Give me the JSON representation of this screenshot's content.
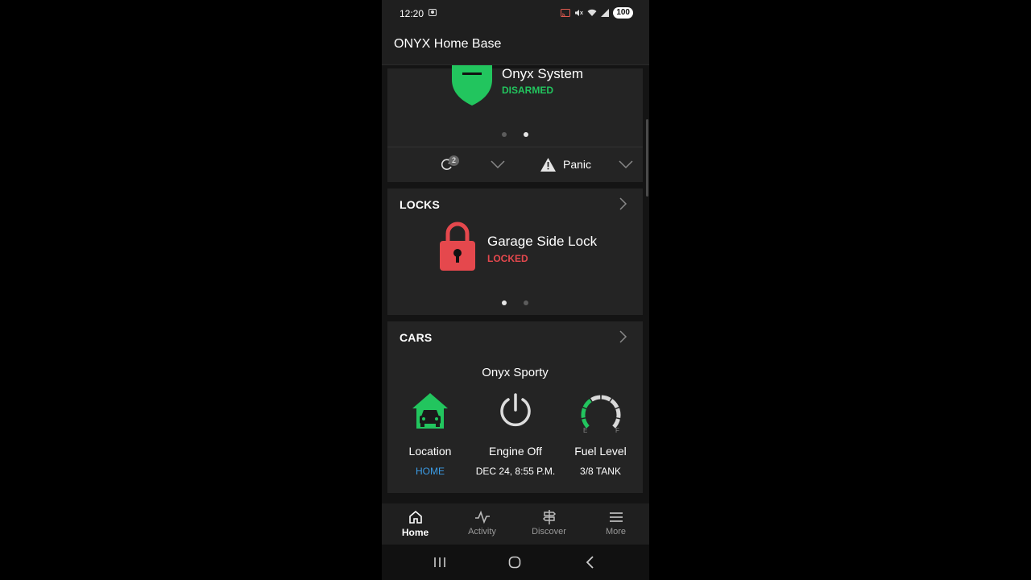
{
  "status_bar": {
    "time": "12:20",
    "battery": "100"
  },
  "app_bar": {
    "title": "ONYX Home Base"
  },
  "security": {
    "name": "Onyx System",
    "state": "DISARMED",
    "state_color": "#22c55e",
    "page_count": 2,
    "active_page": 2,
    "automation_badge": "2",
    "panic_label": "Panic"
  },
  "locks": {
    "header": "LOCKS",
    "name": "Garage Side Lock",
    "state": "LOCKED",
    "state_color": "#e5484d",
    "page_count": 2,
    "active_page": 1
  },
  "cars": {
    "header": "CARS",
    "name": "Onyx Sporty",
    "location": {
      "label": "Location",
      "value": "HOME"
    },
    "engine": {
      "label": "Engine Off",
      "value": "DEC 24, 8:55 P.M."
    },
    "fuel": {
      "label": "Fuel Level",
      "value": "3/8 TANK",
      "empty_mark": "E",
      "full_mark": "F",
      "level_fraction": 0.375
    }
  },
  "bottom_nav": {
    "items": [
      {
        "label": "Home",
        "icon": "home-icon",
        "active": true
      },
      {
        "label": "Activity",
        "icon": "activity-icon",
        "active": false
      },
      {
        "label": "Discover",
        "icon": "signpost-icon",
        "active": false
      },
      {
        "label": "More",
        "icon": "menu-icon",
        "active": false
      }
    ]
  }
}
